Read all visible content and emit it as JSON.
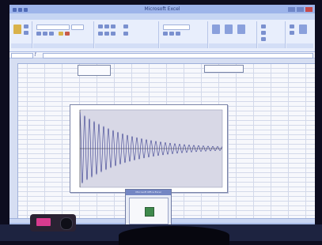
{
  "app": {
    "title": "Microsoft Excel"
  },
  "ribbon": {
    "tabs": [],
    "groups": []
  },
  "notification": {
    "caption": "Microsoft Office Excel"
  },
  "chart_data": {
    "type": "line",
    "title": "",
    "series": [
      {
        "name": "",
        "color": "#3a3f8f",
        "x_min": 0,
        "x_max": 100,
        "amplitude": 1.0,
        "decay": 0.03,
        "oscillations": 30
      }
    ],
    "grid": false,
    "background": "#d8d8e6"
  },
  "colors": {
    "accent": "#9db4ea",
    "ribbon": "#e8eefc",
    "plot_area": "#d8d8e6",
    "series": "#3a3f8f"
  }
}
